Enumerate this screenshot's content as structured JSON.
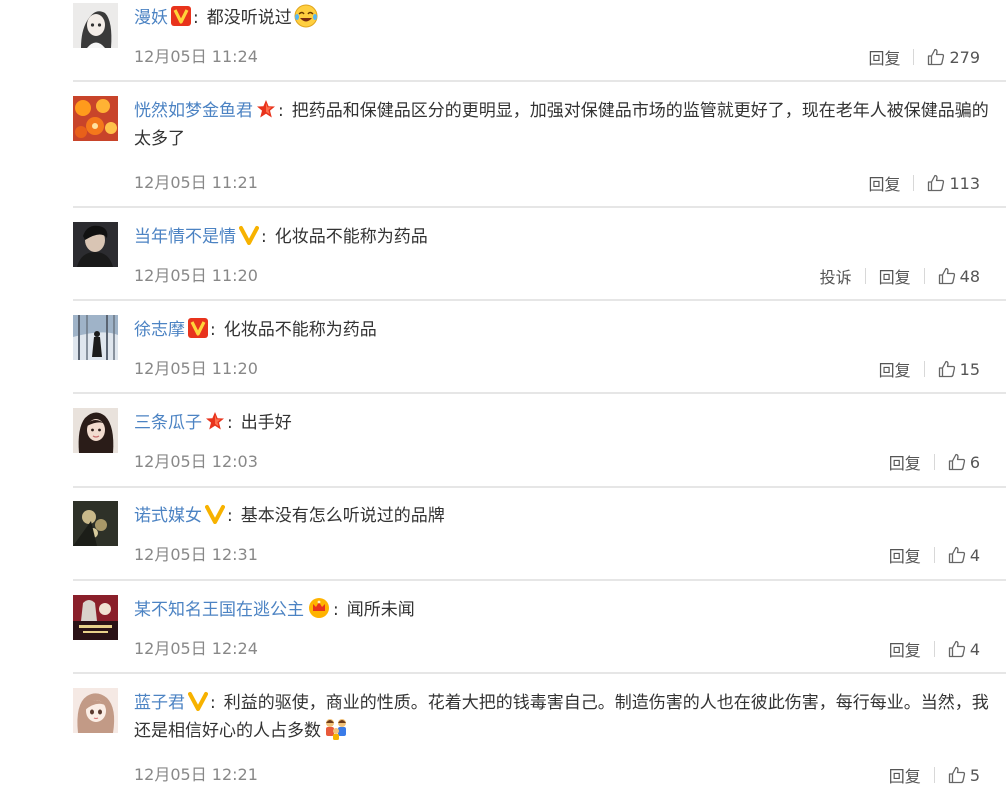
{
  "colors": {
    "username": "#4c83c3",
    "text": "#333333",
    "meta": "#888888",
    "separator": "#e6e6e6"
  },
  "action_labels": {
    "reply": "回复",
    "report": "投诉"
  },
  "comments": [
    {
      "user": "漫妖",
      "badge": "v-red",
      "text": "都没听说过",
      "emoji": "laughing-crying-emoji",
      "time": "12月05日 11:24",
      "likes": "279",
      "report": false,
      "avatar": "girl-sketch"
    },
    {
      "user": "恍然如梦金鱼君",
      "badge": "star-red",
      "text": "把药品和保健品区分的更明显，加强对保健品市场的监管就更好了，现在老年人被保健品骗的太多了",
      "emoji": "",
      "time": "12月05日 11:21",
      "likes": "113",
      "report": false,
      "avatar": "orange-slices"
    },
    {
      "user": "当年情不是情",
      "badge": "v-yellow",
      "text": "化妆品不能称为药品",
      "emoji": "",
      "time": "12月05日 11:20",
      "likes": "48",
      "report": true,
      "avatar": "dark-portrait"
    },
    {
      "user": "徐志摩",
      "badge": "v-red",
      "text": "化妆品不能称为药品",
      "emoji": "",
      "time": "12月05日 11:20",
      "likes": "15",
      "report": false,
      "avatar": "snow-forest"
    },
    {
      "user": "三条瓜子",
      "badge": "star-red",
      "text": "出手好",
      "emoji": "",
      "time": "12月05日 12:03",
      "likes": "6",
      "report": false,
      "avatar": "girl-photo"
    },
    {
      "user": "诺式媒女",
      "badge": "v-yellow",
      "text": "基本没有怎么听说过的品牌",
      "emoji": "",
      "time": "12月05日 12:31",
      "likes": "4",
      "report": false,
      "avatar": "dark-flowers"
    },
    {
      "user": "某不知名王国在逃公主",
      "badge": "crown",
      "text": "闻所未闻",
      "emoji": "",
      "time": "12月05日 12:24",
      "likes": "4",
      "report": false,
      "avatar": "anime-poster"
    },
    {
      "user": "蓝子君",
      "badge": "v-yellow",
      "text": "利益的驱使，商业的性质。花着大把的钱毒害自己。制造伤害的人也在彼此伤害，每行每业。当然，我还是相信好心的人占多数",
      "emoji": "family-emoji",
      "time": "12月05日 12:21",
      "likes": "5",
      "report": false,
      "avatar": "anime-girl"
    }
  ]
}
